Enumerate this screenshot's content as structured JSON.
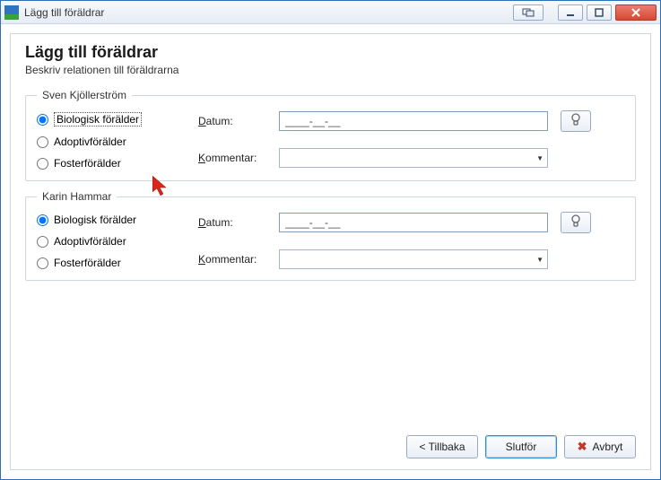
{
  "window": {
    "title": "Lägg till föräldrar"
  },
  "header": {
    "title": "Lägg till föräldrar",
    "subtitle": "Beskriv relationen till föräldrarna"
  },
  "parents": [
    {
      "name": "Sven Kjöllerström",
      "selected": "bio",
      "options": {
        "bio": "Biologisk förälder",
        "adopt": "Adoptivförälder",
        "foster": "Fosterförälder"
      },
      "date_label": "Datum:",
      "date_value": "____-__-__",
      "comment_label_pre": "K",
      "comment_label_rest": "ommentar:",
      "comment_value": ""
    },
    {
      "name": "Karin Hammar",
      "selected": "bio",
      "options": {
        "bio": "Biologisk förälder",
        "adopt": "Adoptivförälder",
        "foster": "Fosterförälder"
      },
      "date_label": "Datum:",
      "date_value": "____-__-__",
      "comment_label_pre": "K",
      "comment_label_rest": "ommentar:",
      "comment_value": ""
    }
  ],
  "buttons": {
    "back": "< Tillbaka",
    "finish": "Slutför",
    "cancel": "Avbryt"
  }
}
